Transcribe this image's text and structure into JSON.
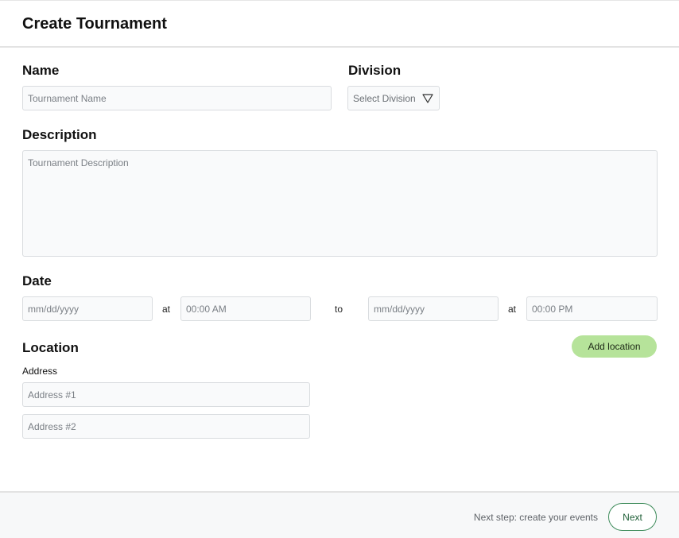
{
  "header": {
    "title": "Create Tournament"
  },
  "name": {
    "label": "Name",
    "placeholder": "Tournament Name"
  },
  "division": {
    "label": "Division",
    "selected": "Select Division"
  },
  "description": {
    "label": "Description",
    "placeholder": "Tournament Description"
  },
  "date": {
    "label": "Date",
    "start_date_placeholder": "mm/dd/yyyy",
    "at_1": "at",
    "start_time_placeholder": "00:00 AM",
    "to": "to",
    "end_date_placeholder": "mm/dd/yyyy",
    "at_2": "at",
    "end_time_placeholder": "00:00 PM"
  },
  "location": {
    "label": "Location",
    "add_button": "Add location",
    "address_label": "Address",
    "address1_placeholder": "Address #1",
    "address2_placeholder": "Address #2"
  },
  "footer": {
    "hint": "Next step: create your events",
    "next_label": "Next"
  },
  "colors": {
    "accent_green": "#b6e39a",
    "next_border": "#3d8b5a"
  },
  "icons": {
    "division_dropdown": "chevron-down-triangle-icon"
  }
}
